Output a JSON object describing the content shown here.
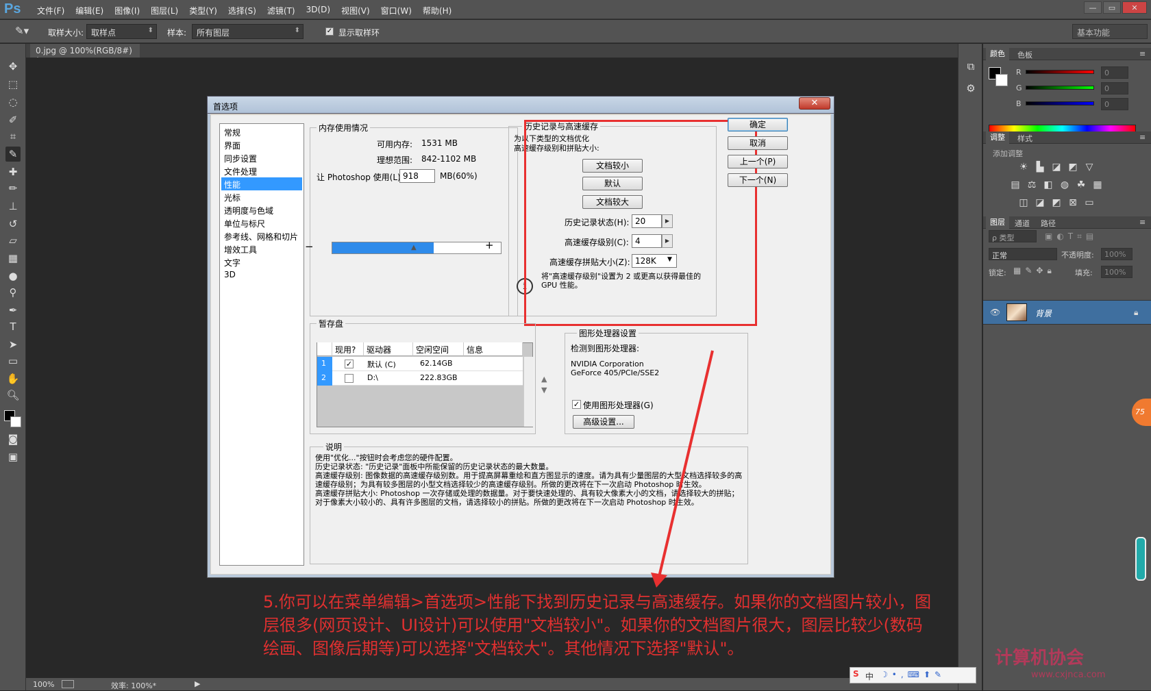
{
  "app": {
    "logo": "Ps"
  },
  "menu": [
    "文件(F)",
    "编辑(E)",
    "图像(I)",
    "图层(L)",
    "类型(Y)",
    "选择(S)",
    "滤镜(T)",
    "3D(D)",
    "视图(V)",
    "窗口(W)",
    "帮助(H)"
  ],
  "window_controls": {
    "minimize": "—",
    "restore": "▭",
    "close": "✕"
  },
  "options": {
    "sample_size_label": "取样大小:",
    "sample_size_value": "取样点",
    "sample_label": "样本:",
    "sample_value": "所有图层",
    "show_ring_label": "显示取样环",
    "workspace": "基本功能"
  },
  "document": {
    "tab": "0.jpg @ 100%(RGB/8#) *"
  },
  "status": {
    "zoom": "100%",
    "efficiency": "效率: 100%*"
  },
  "panels": {
    "color_tab": "颜色",
    "swatch_tab": "色板",
    "r": "R",
    "g": "G",
    "b": "B",
    "r_val": "0",
    "g_val": "0",
    "b_val": "0",
    "adjust_tab": "调整",
    "style_tab": "样式",
    "add_adjust": "添加调整",
    "layers_tab": "图层",
    "channels_tab": "通道",
    "paths_tab": "路径",
    "kind": "ρ 类型",
    "blend": "正常",
    "opacity_label": "不透明度:",
    "opacity": "100%",
    "lock_label": "锁定:",
    "fill_label": "填充:",
    "fill": "100%",
    "layer_name": "背景"
  },
  "dialog": {
    "title": "首选项",
    "nav": [
      "常规",
      "界面",
      "同步设置",
      "文件处理",
      "性能",
      "光标",
      "透明度与色域",
      "单位与标尺",
      "参考线、网格和切片",
      "增效工具",
      "文字",
      "3D"
    ],
    "buttons": {
      "ok": "确定",
      "cancel": "取消",
      "prev": "上一个(P)",
      "next": "下一个(N)"
    },
    "memory": {
      "title": "内存使用情况",
      "avail_label": "可用内存:",
      "avail": "1531 MB",
      "ideal_label": "理想范围:",
      "ideal": "842-1102 MB",
      "use_label": "让 Photoshop 使用(L):",
      "use": "918",
      "unit": "MB(60%)",
      "minus": "−",
      "plus": "+",
      "fill_fraction": 0.6
    },
    "history": {
      "title": "历史记录与高速缓存",
      "desc": "为以下类型的文档优化\n高速缓存级别和拼贴大小:",
      "btn_small": "文档较小",
      "btn_default": "默认",
      "btn_large": "文档较大",
      "states_label": "历史记录状态(H):",
      "states": "20",
      "levels_label": "高速缓存级别(C):",
      "levels": "4",
      "tile_label": "高速缓存拼贴大小(Z):",
      "tile": "128K",
      "note": "将\"高速缓存级别\"设置为 2 或更高以获得最佳的\nGPU 性能。"
    },
    "scratch": {
      "title": "暂存盘",
      "headers": [
        "现用?",
        "驱动器",
        "空闲空间",
        "信息"
      ],
      "rows": [
        {
          "num": "1",
          "active": true,
          "drive": "默认 (C)",
          "free": "62.14GB"
        },
        {
          "num": "2",
          "active": false,
          "drive": "D:\\",
          "free": "222.83GB"
        }
      ]
    },
    "gpu": {
      "title": "图形处理器设置",
      "detected": "检测到图形处理器:",
      "card1": "NVIDIA Corporation",
      "card2": "GeForce 405/PCIe/SSE2",
      "use_label": "使用图形处理器(G)",
      "advanced": "高级设置..."
    },
    "description": {
      "title": "说明",
      "text": "使用\"优化...\"按钮时会考虑您的硬件配置。\n历史记录状态: \"历史记录\"面板中所能保留的历史记录状态的最大数量。\n高速缓存级别: 图像数据的高速缓存级别数。用于提高屏幕重绘和直方图显示的速度。请为具有少量图层的大型文档选择较多的高速缓存级别；为具有较多图层的小型文档选择较少的高速缓存级别。所做的更改将在下一次启动 Photoshop 时生效。\n高速缓存拼贴大小: Photoshop 一次存储或处理的数据量。对于要快速处理的、具有较大像素大小的文档，请选择较大的拼贴；对于像素大小较小的、具有许多图层的文档，请选择较小的拼贴。所做的更改将在下一次启动 Photoshop 时生效。"
    }
  },
  "annotation": "5.你可以在菜单编辑>首选项>性能下找到历史记录与高速缓存。如果你的文档图片较小，图层很多(网页设计、UI设计)可以使用\"文档较小\"。如果你的文档图片很大，图层比较少(数码绘画、图像后期等)可以选择\"文档较大\"。其他情况下选择\"默认\"。",
  "watermark": "计算机协会",
  "watermark_url": "www.cxjnca.com",
  "ime": "中",
  "badge": "75",
  "colors": {
    "annotation": "#e03030",
    "selection": "#3399ff",
    "accent": "#2f8bea"
  }
}
